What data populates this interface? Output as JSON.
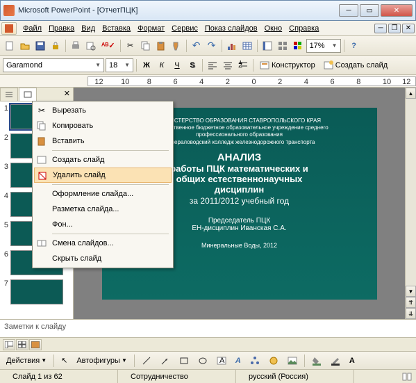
{
  "title": "Microsoft PowerPoint - [ОтчетПЦК]",
  "menu": [
    "Файл",
    "Правка",
    "Вид",
    "Вставка",
    "Формат",
    "Сервис",
    "Показ слайдов",
    "Окно",
    "Справка"
  ],
  "font": {
    "name": "Garamond",
    "size": "18"
  },
  "zoom": "17%",
  "toolbar2": {
    "konstruktor": "Конструктор",
    "create_slide": "Создать слайд"
  },
  "ruler_ticks": [
    "12",
    "10",
    "8",
    "6",
    "4",
    "2",
    "0",
    "2",
    "4",
    "6",
    "8",
    "10",
    "12"
  ],
  "thumbs": [
    {
      "num": "1",
      "sel": true
    },
    {
      "num": "2"
    },
    {
      "num": "3"
    },
    {
      "num": "4"
    },
    {
      "num": "5"
    },
    {
      "num": "6"
    },
    {
      "num": "7"
    }
  ],
  "context_menu": [
    {
      "type": "item",
      "icon": "cut",
      "label": "Вырезать"
    },
    {
      "type": "item",
      "icon": "copy",
      "label": "Копировать"
    },
    {
      "type": "item",
      "icon": "paste",
      "label": "Вставить"
    },
    {
      "type": "sep"
    },
    {
      "type": "item",
      "icon": "new",
      "label": "Создать слайд"
    },
    {
      "type": "item",
      "icon": "delete",
      "label": "Удалить слайд",
      "hl": true
    },
    {
      "type": "sep"
    },
    {
      "type": "item",
      "icon": "",
      "label": "Оформление слайда..."
    },
    {
      "type": "item",
      "icon": "",
      "label": "Разметка слайда..."
    },
    {
      "type": "item",
      "icon": "",
      "label": "Фон..."
    },
    {
      "type": "sep"
    },
    {
      "type": "item",
      "icon": "trans",
      "label": "Смена слайдов..."
    },
    {
      "type": "item",
      "icon": "",
      "label": "Скрыть слайд"
    }
  ],
  "slide": {
    "line1": "МИНИСТЕРСТВО ОБРАЗОВАНИЯ СТАВРОПОЛЬСКОГО КРАЯ",
    "line2": "Государственное бюджетное образовательное учреждение среднего",
    "line3": "профессионального образования",
    "line4": "Минераловодский колледж железнодорожного транспорта",
    "h1": "АНАЛИЗ",
    "h2a": "работы ПЦК математических и",
    "h2b": "общих естественнонаучных",
    "h2c": "дисциплин",
    "year": "за 2011/2012 учебный год",
    "chair1": "Председатель ПЦК",
    "chair2": "ЕН-дисциплин Иванская С.А.",
    "foot": "Минеральные Воды, 2012"
  },
  "notes_placeholder": "Заметки к слайду",
  "draw": {
    "actions": "Действия",
    "autoshapes": "Автофигуры"
  },
  "status": {
    "slide": "Слайд 1 из 62",
    "template": "Сотрудничество",
    "lang": "русский (Россия)"
  }
}
